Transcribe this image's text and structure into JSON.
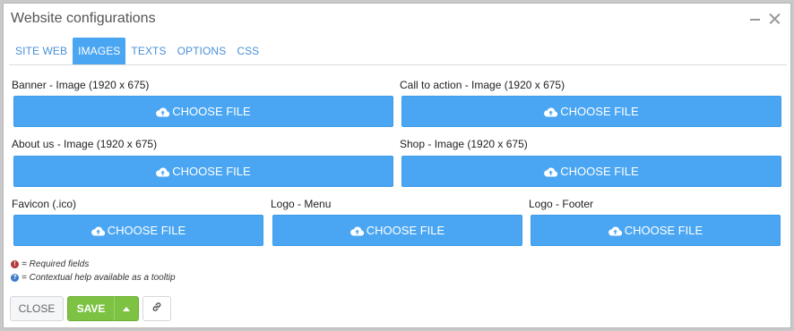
{
  "window": {
    "title": "Website configurations"
  },
  "tabs": [
    {
      "label": "SITE WEB",
      "active": false
    },
    {
      "label": "IMAGES",
      "active": true
    },
    {
      "label": "TEXTS",
      "active": false
    },
    {
      "label": "OPTIONS",
      "active": false
    },
    {
      "label": "CSS",
      "active": false
    }
  ],
  "fields": {
    "banner": {
      "label": "Banner - Image (1920 x 675)",
      "button": "CHOOSE FILE"
    },
    "cta": {
      "label": "Call to action - Image (1920 x 675)",
      "button": "CHOOSE FILE"
    },
    "about": {
      "label": "About us - Image (1920 x 675)",
      "button": "CHOOSE FILE"
    },
    "shop": {
      "label": "Shop - Image (1920 x 675)",
      "button": "CHOOSE FILE"
    },
    "favicon": {
      "label": "Favicon (.ico)",
      "button": "CHOOSE FILE"
    },
    "logo_menu": {
      "label": "Logo - Menu",
      "button": "CHOOSE FILE"
    },
    "logo_footer": {
      "label": "Logo - Footer",
      "button": "CHOOSE FILE"
    }
  },
  "legend": {
    "required": "= Required fields",
    "help": "= Contextual help available as a tooltip"
  },
  "footer": {
    "close_label": "CLOSE",
    "save_label": "SAVE"
  },
  "colors": {
    "accent_blue": "#4aa6f2",
    "save_green": "#7dc242",
    "required_red": "#b33a3a",
    "help_blue": "#3a7cc9"
  },
  "icons": {
    "upload": "cloud-upload-icon",
    "link": "link-icon",
    "minimize": "minimize-icon",
    "close": "close-icon"
  }
}
